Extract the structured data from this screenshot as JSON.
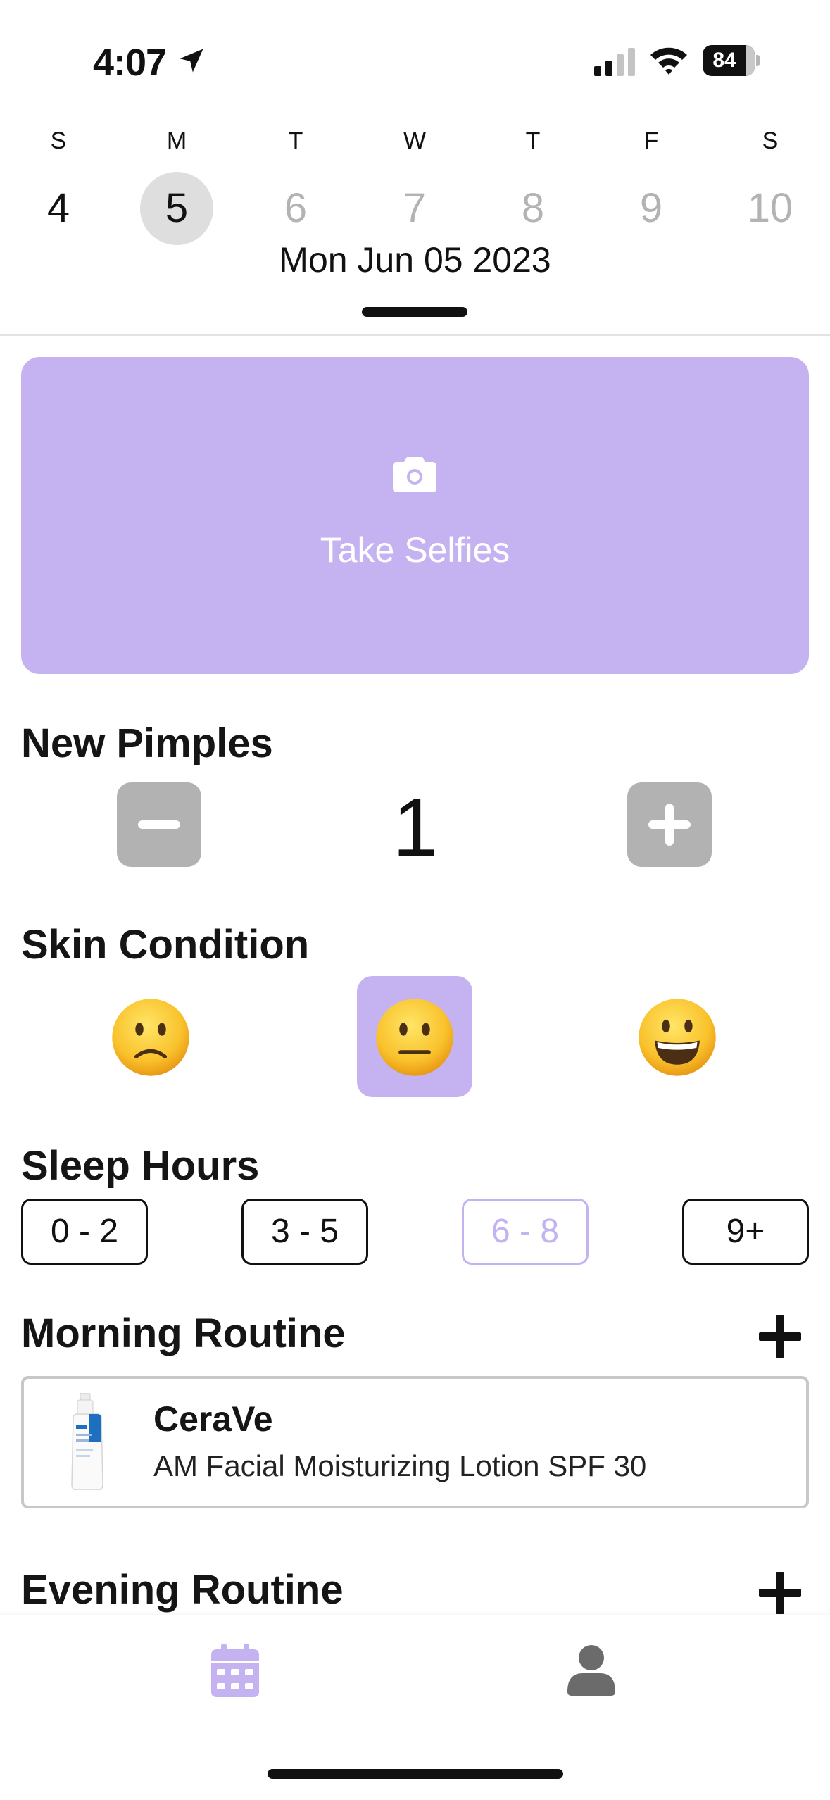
{
  "status_bar": {
    "time": "4:07",
    "battery_percent": "84",
    "battery_level": 0.84
  },
  "calendar": {
    "days": [
      {
        "letter": "S",
        "number": "4",
        "state": "active"
      },
      {
        "letter": "M",
        "number": "5",
        "state": "selected"
      },
      {
        "letter": "T",
        "number": "6",
        "state": "future"
      },
      {
        "letter": "W",
        "number": "7",
        "state": "future"
      },
      {
        "letter": "T",
        "number": "8",
        "state": "future"
      },
      {
        "letter": "F",
        "number": "9",
        "state": "future"
      },
      {
        "letter": "S",
        "number": "10",
        "state": "future"
      }
    ],
    "selected_date": "Mon Jun 05 2023"
  },
  "selfie": {
    "label": "Take Selfies",
    "icon": "camera-icon"
  },
  "pimples": {
    "title": "New Pimples",
    "count": "1"
  },
  "skin_condition": {
    "title": "Skin Condition",
    "options": [
      "slightly-frowning-face",
      "neutral-face",
      "grinning-face"
    ],
    "selected_index": 1
  },
  "sleep": {
    "title": "Sleep Hours",
    "options": [
      "0 - 2",
      "3 - 5",
      "6 - 8",
      "9+"
    ],
    "selected_index": 2
  },
  "morning_routine": {
    "title": "Morning Routine",
    "products": [
      {
        "brand": "CeraVe",
        "name": "AM Facial Moisturizing Lotion SPF 30"
      }
    ]
  },
  "evening_routine": {
    "title": "Evening Routine"
  },
  "tab_bar": {
    "tabs": [
      {
        "icon": "calendar-icon",
        "active": true
      },
      {
        "icon": "profile-icon",
        "active": false
      }
    ]
  },
  "colors": {
    "accent": "#c5b3f1",
    "text": "#111111",
    "muted": "#b3b3b3",
    "stepper_gray": "#b2b2b2"
  }
}
